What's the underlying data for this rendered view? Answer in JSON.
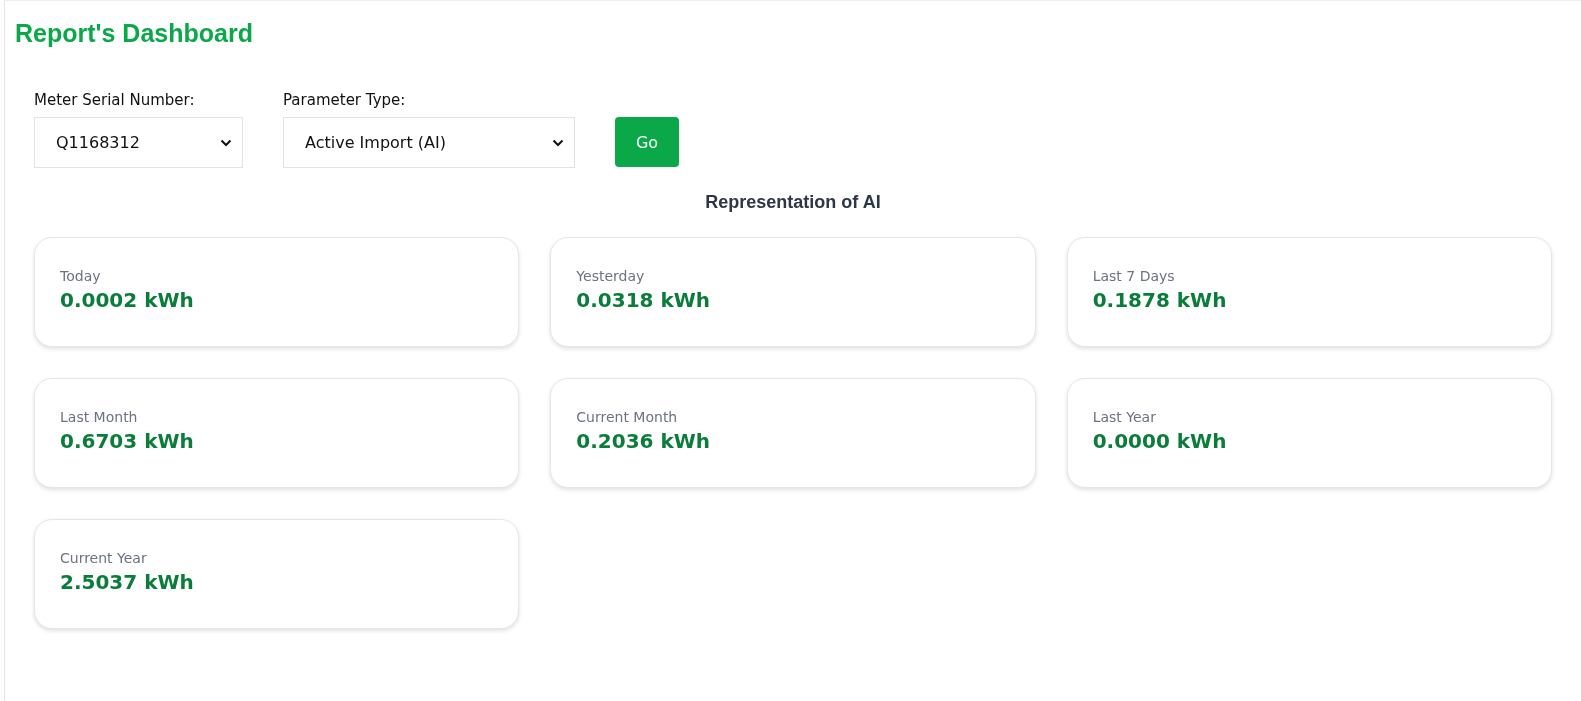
{
  "title": "Report's Dashboard",
  "filters": [
    {
      "label": "Meter Serial Number:",
      "value": "Q1168312"
    },
    {
      "label": "Parameter Type:",
      "value": "Active Import (AI)"
    }
  ],
  "go_button": "Go",
  "section_title": "Representation of AI",
  "cards": [
    {
      "label": "Today",
      "value": "0.0002 kWh"
    },
    {
      "label": "Yesterday",
      "value": "0.0318 kWh"
    },
    {
      "label": "Last 7 Days",
      "value": "0.1878 kWh"
    },
    {
      "label": "Last Month",
      "value": "0.6703 kWh"
    },
    {
      "label": "Current Month",
      "value": "0.2036 kWh"
    },
    {
      "label": "Last Year",
      "value": "0.0000 kWh"
    },
    {
      "label": "Current Year",
      "value": "2.5037 kWh"
    }
  ]
}
